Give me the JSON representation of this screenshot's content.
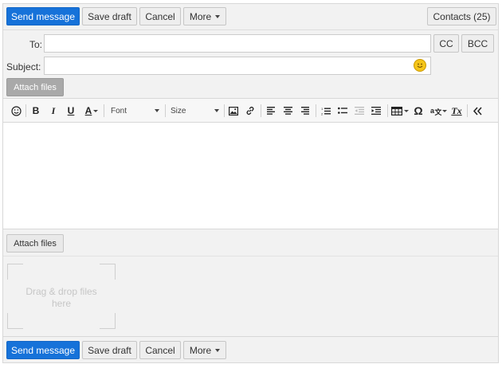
{
  "top_bar": {
    "send_label": "Send message",
    "save_draft_label": "Save draft",
    "cancel_label": "Cancel",
    "more_label": "More",
    "contacts_label": "Contacts (25)"
  },
  "recipients": {
    "to_label": "To:",
    "to_value": "",
    "cc_label": "CC",
    "bcc_label": "BCC",
    "subject_label": "Subject:",
    "subject_value": ""
  },
  "attach_top_label": "Attach files",
  "toolbar": {
    "bold": "B",
    "italic": "I",
    "underline": "U",
    "font_color": "A",
    "font_label": "Font",
    "size_label": "Size",
    "omega": "Ω",
    "clear_format": "Tx"
  },
  "attachments": {
    "attach_label": "Attach files",
    "dropzone_text": "Drag & drop files here"
  },
  "bottom_bar": {
    "send_label": "Send message",
    "save_draft_label": "Save draft",
    "cancel_label": "Cancel",
    "more_label": "More"
  },
  "colors": {
    "primary": "#1672d9",
    "frame_bg": "#f2f2f2"
  }
}
